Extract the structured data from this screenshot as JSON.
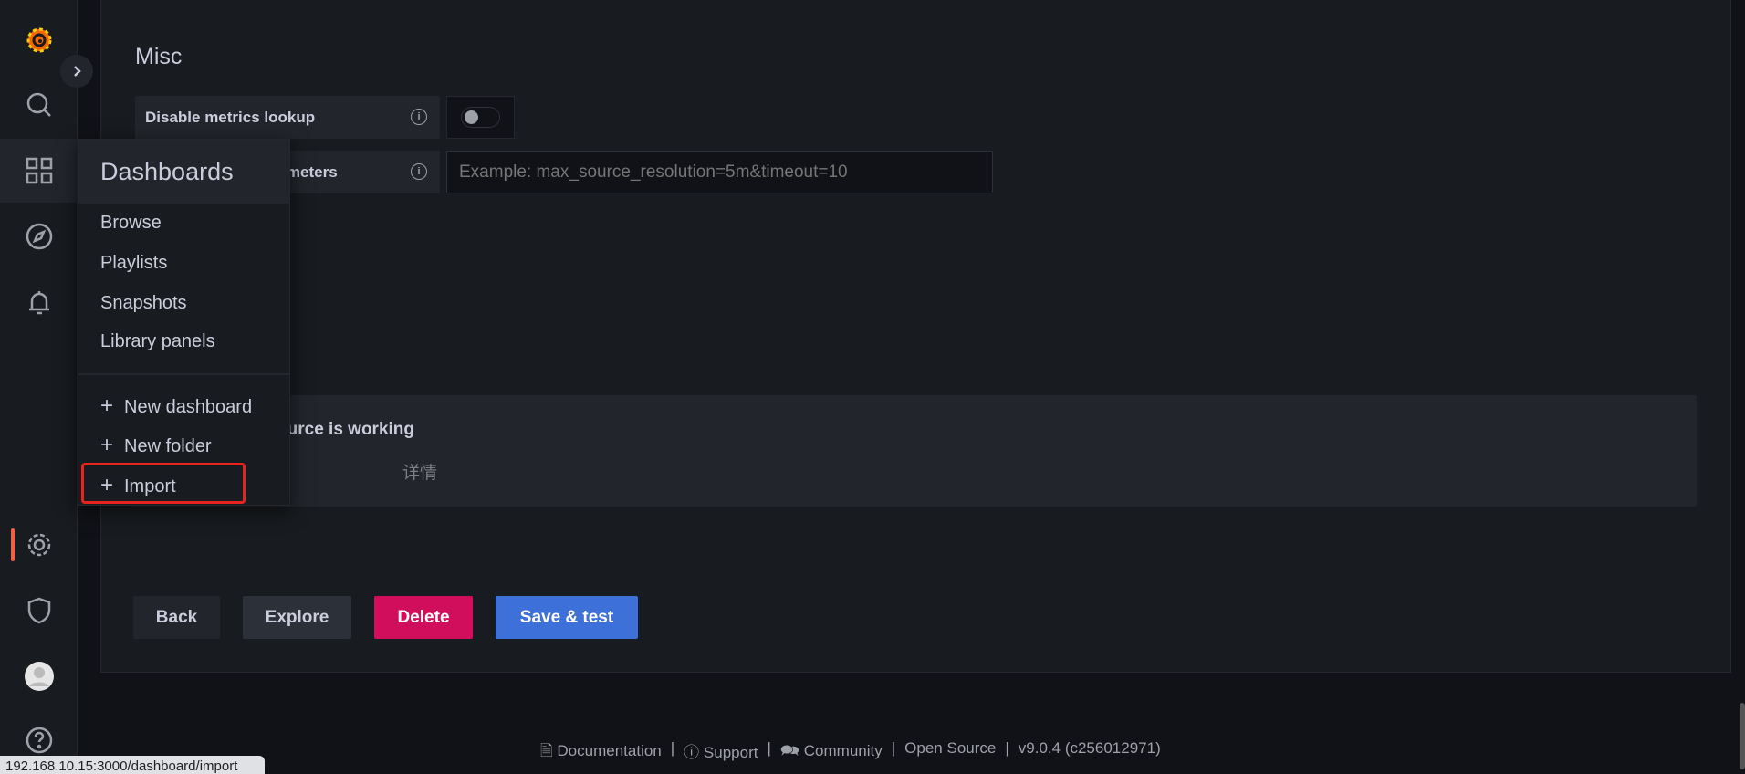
{
  "sidebar": {
    "items": [
      "grafana-logo",
      "search",
      "dashboards",
      "explore",
      "alerting",
      "configuration",
      "server-admin",
      "profile",
      "help"
    ],
    "accent": "#f55f3e"
  },
  "main": {
    "section_title": "Misc",
    "fields": [
      {
        "label": "Disable metrics lookup",
        "type": "toggle",
        "value": false
      },
      {
        "label": "Custom query parameters",
        "type": "text",
        "value": "",
        "placeholder": "Example: max_source_resolution=5m&timeout=10"
      }
    ],
    "alert": {
      "title": "Data source is working",
      "subtitle": "详情"
    },
    "buttons": {
      "back": "Back",
      "explore": "Explore",
      "delete": "Delete",
      "save": "Save & test"
    }
  },
  "menu": {
    "title": "Dashboards",
    "items": [
      "Browse",
      "Playlists",
      "Snapshots",
      "Library panels"
    ],
    "actions": [
      "New dashboard",
      "New folder",
      "Import"
    ],
    "highlighted": "Import"
  },
  "footer": {
    "documentation": "Documentation",
    "support": "Support",
    "community": "Community",
    "open_source": "Open Source",
    "version": "v9.0.4 (c256012971)",
    "sep": "|"
  },
  "status_bar": "192.168.10.15:3000/dashboard/import",
  "colors": {
    "delete": "#d10e5c",
    "primary": "#3d71d9",
    "highlight": "#e8221c"
  }
}
